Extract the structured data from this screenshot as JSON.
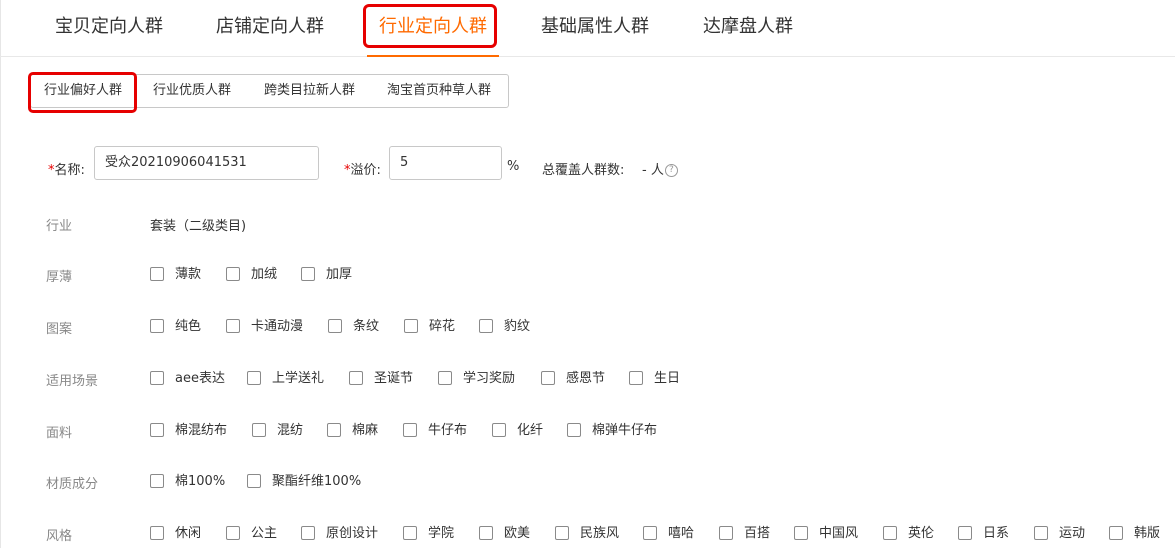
{
  "top_tabs": [
    "宝贝定向人群",
    "店铺定向人群",
    "行业定向人群",
    "基础属性人群",
    "达摩盘人群"
  ],
  "active_top_tab": "行业定向人群",
  "sub_tabs": [
    "行业偏好人群",
    "行业优质人群",
    "跨类目拉新人群",
    "淘宝首页种草人群"
  ],
  "active_sub_tab": "行业偏好人群",
  "form": {
    "required_mark": "*",
    "name_label": "名称:",
    "name_value": "受众20210906041531",
    "premium_label": "溢价:",
    "premium_value": "5",
    "premium_suffix": "%",
    "coverage_label": "总覆盖人群数:",
    "coverage_value": "- 人",
    "help_glyph": "?"
  },
  "industry": {
    "label": "行业",
    "value": "套装（二级类目)"
  },
  "attributes": [
    {
      "label": "厚薄",
      "options": [
        "薄款",
        "加绒",
        "加厚"
      ]
    },
    {
      "label": "图案",
      "options": [
        "纯色",
        "卡通动漫",
        "条纹",
        "碎花",
        "豹纹"
      ]
    },
    {
      "label": "适用场景",
      "options": [
        "aee表达",
        "上学送礼",
        "圣诞节",
        "学习奖励",
        "感恩节",
        "生日"
      ]
    },
    {
      "label": "面料",
      "options": [
        "棉混纺布",
        "混纺",
        "棉麻",
        "牛仔布",
        "化纤",
        "棉弹牛仔布"
      ]
    },
    {
      "label": "材质成分",
      "options": [
        "棉100%",
        "聚酯纤维100%"
      ]
    },
    {
      "label": "风格",
      "options": [
        "休闲",
        "公主",
        "原创设计",
        "学院",
        "欧美",
        "民族风",
        "嘻哈",
        "百搭",
        "中国风",
        "英伦",
        "日系",
        "运动",
        "韩版"
      ]
    }
  ],
  "colors": {
    "accent": "#ff6a00",
    "highlight_box": "#e60000"
  }
}
